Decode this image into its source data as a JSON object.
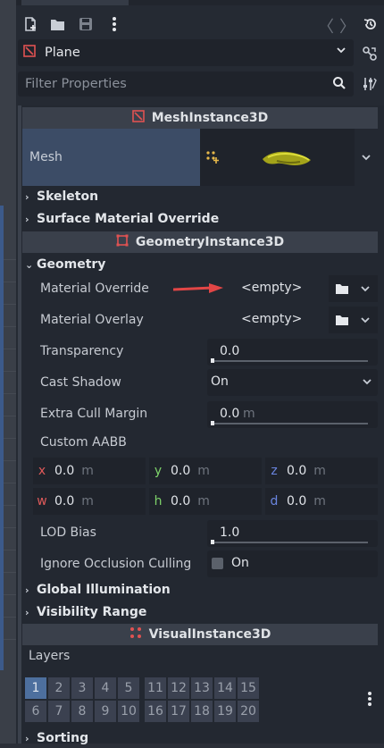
{
  "toolbar": {
    "icons": [
      "new-script-icon",
      "open-folder-icon",
      "save-icon",
      "more-vert-icon"
    ],
    "nav_back": "〈",
    "nav_fwd": "〉"
  },
  "node_select": {
    "name": "Plane"
  },
  "filter": {
    "placeholder": "Filter Properties"
  },
  "headers": {
    "mesh_instance": "MeshInstance3D",
    "geometry_instance": "GeometryInstance3D",
    "visual_instance": "VisualInstance3D"
  },
  "mesh": {
    "label": "Mesh"
  },
  "sections": {
    "skeleton": "Skeleton",
    "surface_material_override": "Surface Material Override",
    "geometry": "Geometry",
    "global_illumination": "Global Illumination",
    "visibility_range": "Visibility Range",
    "sorting": "Sorting"
  },
  "geometry": {
    "material_override": {
      "label": "Material Override",
      "value": "<empty>"
    },
    "material_overlay": {
      "label": "Material Overlay",
      "value": "<empty>"
    },
    "transparency": {
      "label": "Transparency",
      "value": "0.0",
      "level": 0
    },
    "cast_shadow": {
      "label": "Cast Shadow",
      "value": "On"
    },
    "extra_cull_margin": {
      "label": "Extra Cull Margin",
      "value": "0.0",
      "unit": "m",
      "level": 0
    },
    "custom_aabb": {
      "label": "Custom AABB",
      "cells": [
        {
          "axis": "x",
          "value": "0.0",
          "unit": "m",
          "color": "#e05a5a"
        },
        {
          "axis": "y",
          "value": "0.0",
          "unit": "m",
          "color": "#7ed36a"
        },
        {
          "axis": "z",
          "value": "0.0",
          "unit": "m",
          "color": "#6a85e0"
        },
        {
          "axis": "w",
          "value": "0.0",
          "unit": "m",
          "color": "#e05a5a"
        },
        {
          "axis": "h",
          "value": "0.0",
          "unit": "m",
          "color": "#7ed36a"
        },
        {
          "axis": "d",
          "value": "0.0",
          "unit": "m",
          "color": "#6a85e0"
        }
      ]
    },
    "lod_bias": {
      "label": "LOD Bias",
      "value": "1.0",
      "level": 0
    },
    "ignore_occlusion_culling": {
      "label": "Ignore Occlusion Culling",
      "value": "On"
    }
  },
  "layers": {
    "label": "Layers",
    "row1": [
      "1",
      "2",
      "3",
      "4",
      "5",
      "11",
      "12",
      "13",
      "14",
      "15"
    ],
    "row2": [
      "6",
      "7",
      "8",
      "9",
      "10",
      "16",
      "17",
      "18",
      "19",
      "20"
    ],
    "active": "1"
  },
  "colors": {
    "accent": "#e05252",
    "selected_layer": "#4d6f9e",
    "mesh_row": "#3c4c66"
  }
}
